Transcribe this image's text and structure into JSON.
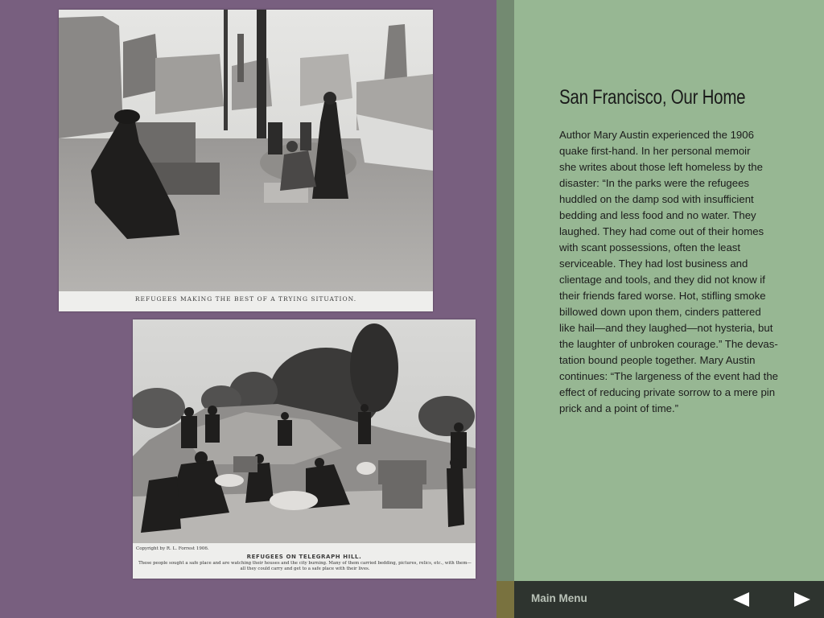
{
  "photos": [
    {
      "caption": "REFUGEES MAKING THE BEST OF A TRYING SITUATION."
    },
    {
      "copyright": "Copyright by R. L. Forrest 1906.",
      "title": "REFUGEES ON TELEGRAPH HILL.",
      "subtitle": "These people sought a safe place and are watching their houses and the city burning.  Many of them carried bedding, pictures, relics, etc., with them—all they could carry and get to a safe place with their lives."
    }
  ],
  "article": {
    "title": "San Francisco, Our Home",
    "lines": [
      "Author Mary Austin experienced the 1906",
      "quake first-hand. In her personal memoir",
      "she writes about those left homeless by the",
      "disaster: “In the parks were the refugees",
      "huddled on the damp sod with insufficient",
      "bedding and less food and no water. They",
      "laughed. They had come out of their homes",
      "with scant possessions, often the least",
      "serviceable. They had lost business and",
      "clientage and tools, and they did not know if",
      "their friends fared worse. Hot, stifling smoke",
      "billowed down upon them, cinders pattered",
      "like hail—and they laughed—not hysteria, but",
      "the laughter of unbroken courage.” The devas-",
      "tation bound people together. Mary Austin",
      "continues: “The largeness of the event had the",
      "effect of reducing private sorrow to a mere pin",
      "prick and a point of time.”"
    ]
  },
  "nav": {
    "main_menu_label": "Main Menu",
    "prev_icon": "triangle-left-icon",
    "next_icon": "triangle-right-icon"
  },
  "colors": {
    "left_background": "#785f7f",
    "right_background": "#97b793",
    "bottom_bar": "#2e342f"
  }
}
